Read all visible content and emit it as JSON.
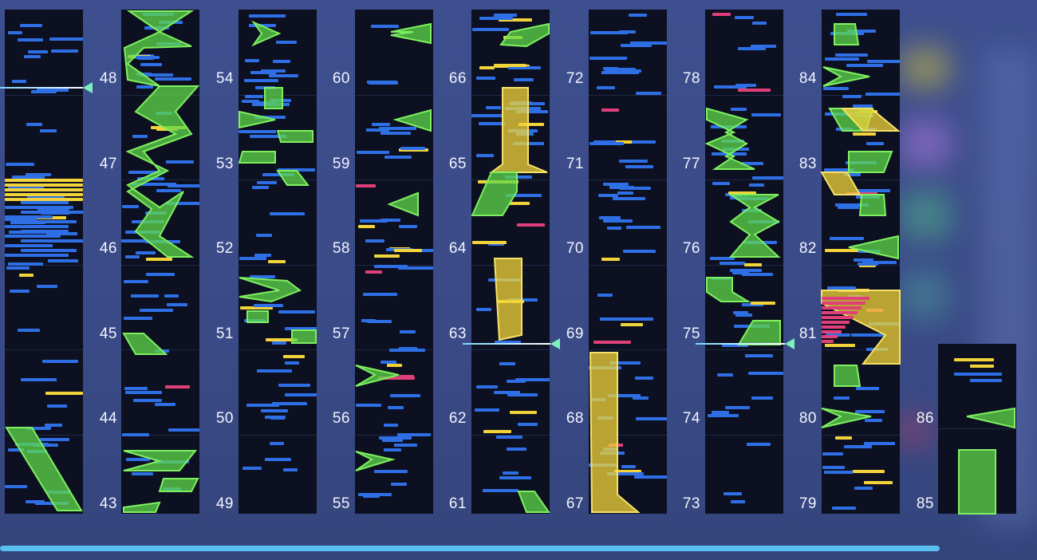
{
  "chart": {
    "measure_labels": [
      [
        "48",
        "47",
        "46",
        "45",
        "44",
        "43"
      ],
      [
        "54",
        "53",
        "52",
        "51",
        "50",
        "49"
      ],
      [
        "60",
        "59",
        "58",
        "57",
        "56",
        "55"
      ],
      [
        "66",
        "65",
        "64",
        "63",
        "62",
        "61"
      ],
      [
        "72",
        "71",
        "70",
        "69",
        "68",
        "67"
      ],
      [
        "78",
        "77",
        "76",
        "75",
        "74",
        "73"
      ],
      [
        "84",
        "83",
        "82",
        "81",
        "80",
        "79"
      ]
    ],
    "last_column_labels": [
      "86",
      "85"
    ],
    "note_colors": {
      "tap": "#2f6fe6",
      "gold": "#f2d43a",
      "flick": "#e0407a",
      "hold": "#5fd84a"
    }
  }
}
